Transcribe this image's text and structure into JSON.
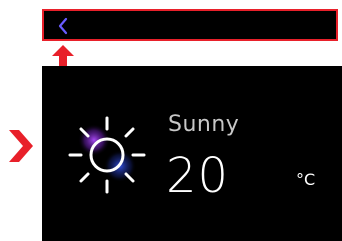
{
  "weather": {
    "condition": "Sunny",
    "temperature": "20",
    "unit": "°C",
    "icon": "sun-icon"
  },
  "navigation": {
    "back_icon": "chevron-left-icon"
  },
  "annotations": {
    "highlight_color": "#e8202a",
    "up_arrow_icon": "arrow-up-icon",
    "side_arrow_icon": "chevron-right-icon"
  },
  "colors": {
    "background": "#000000",
    "accent": "#6a5cff",
    "sun_glow": "#8a2be2",
    "text_primary": "#ffffff",
    "text_secondary": "#c8c8c8"
  }
}
